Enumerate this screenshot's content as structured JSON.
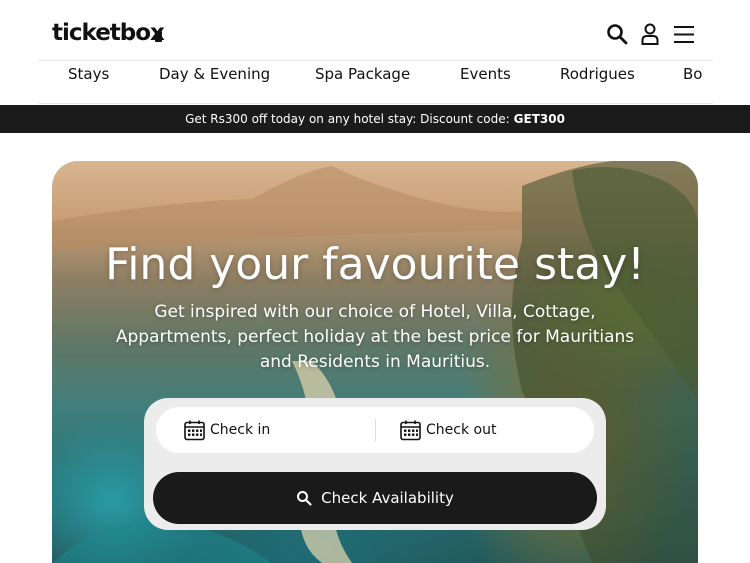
{
  "header": {
    "logo_text": "ticketbox",
    "icons": [
      "search-icon",
      "user-icon",
      "hamburger-menu-icon"
    ]
  },
  "nav": {
    "items": [
      {
        "label": "Stays"
      },
      {
        "label": "Day & Evening"
      },
      {
        "label": "Spa Package"
      },
      {
        "label": "Events"
      },
      {
        "label": "Rodrigues"
      },
      {
        "label": "Bo"
      }
    ]
  },
  "promo": {
    "text": "Get Rs300 off today on any hotel stay: Discount code:",
    "code": "GET300"
  },
  "hero": {
    "title": "Find your favourite stay!",
    "subtitle": "Get inspired with our choice of Hotel, Villa, Cottage, Appartments, perfect holiday at the best price for Mauritians and Residents in Mauritius."
  },
  "booking": {
    "check_in_label": "Check in",
    "check_out_label": "Check out",
    "submit_label": "Check Availability"
  },
  "colors": {
    "promo_bg": "#1b1b1b",
    "button_bg": "#1a1a1a",
    "booking_panel_bg": "#ececec"
  }
}
